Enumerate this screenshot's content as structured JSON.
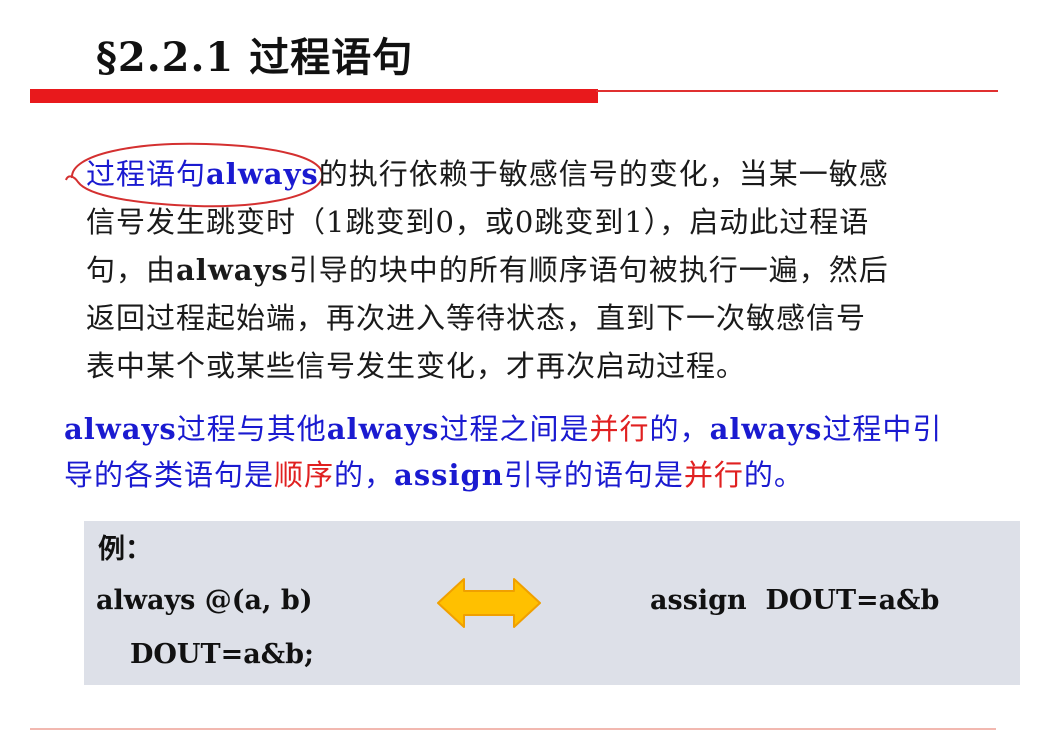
{
  "slide": {
    "title": "§2.2.1 过程语句"
  },
  "para1": {
    "l1a": "过程语句",
    "l1b": "always",
    "l1c": "的执行依赖于敏感信号的变化，当某一敏感",
    "l2": "信号发生跳变时（1跳变到0，或0跳变到1），启动此过程语",
    "l3a": "句，由",
    "l3b": "always",
    "l3c": "引导的块中的所有顺序语句被执行一遍，然后",
    "l4": "返回过程起始端，再次进入等待状态，直到下一次敏感信号",
    "l5": "表中某个或某些信号发生变化，才再次启动过程。"
  },
  "para2": {
    "l1a": "always",
    "l1b": "过程与其他",
    "l1c": "always",
    "l1d": "过程之间是",
    "l1e": "并行",
    "l1f": "的，",
    "l1g": "always",
    "l1h": "过程中引",
    "l2a": "导的各类语句是",
    "l2b": "顺序",
    "l2c": "的，",
    "l2d": "assign",
    "l2e": "引导的语句是",
    "l2f": "并行",
    "l2g": "的。"
  },
  "example": {
    "label": "例：",
    "code_line1": "always @(a, b)",
    "code_line2": "DOUT=a&b;",
    "assign_code": "assign  DOUT=a&b",
    "arrow_icon": "double-arrow-icon"
  },
  "colors": {
    "accent_red": "#e8191c",
    "text_blue": "#1a1ad0",
    "highlight_red": "#e02020",
    "box_bg": "#dde0e8",
    "arrow_fill": "#ffc000",
    "arrow_stroke": "#f0a000"
  }
}
